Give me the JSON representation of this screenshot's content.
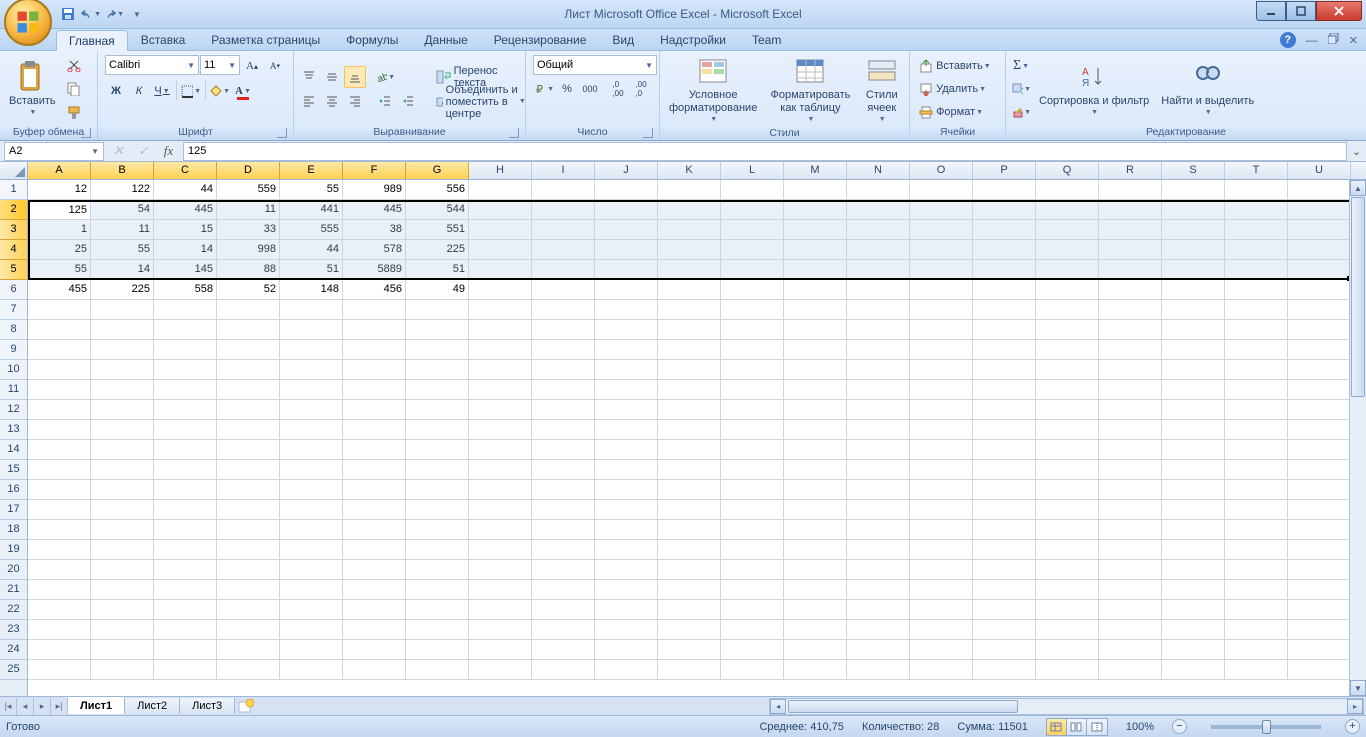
{
  "title": "Лист Microsoft Office Excel - Microsoft Excel",
  "tabs": [
    "Главная",
    "Вставка",
    "Разметка страницы",
    "Формулы",
    "Данные",
    "Рецензирование",
    "Вид",
    "Надстройки",
    "Team"
  ],
  "activeTab": 0,
  "ribbon": {
    "clipboard": {
      "label": "Буфер обмена",
      "paste": "Вставить"
    },
    "font": {
      "label": "Шрифт",
      "name": "Calibri",
      "size": "11",
      "bold": "Ж",
      "italic": "К",
      "underline": "Ч"
    },
    "alignment": {
      "label": "Выравнивание",
      "wrap": "Перенос текста",
      "merge": "Объединить и поместить в центре"
    },
    "number": {
      "label": "Число",
      "format": "Общий"
    },
    "styles": {
      "label": "Стили",
      "cond": "Условное форматирование",
      "table": "Форматировать как таблицу",
      "cell": "Стили ячеек"
    },
    "cells": {
      "label": "Ячейки",
      "insert": "Вставить",
      "delete": "Удалить",
      "format": "Формат"
    },
    "editing": {
      "label": "Редактирование",
      "sort": "Сортировка и фильтр",
      "find": "Найти и выделить"
    }
  },
  "namebox": "A2",
  "formula": "125",
  "columns": [
    "A",
    "B",
    "C",
    "D",
    "E",
    "F",
    "G",
    "H",
    "I",
    "J",
    "K",
    "L",
    "M",
    "N",
    "O",
    "P",
    "Q",
    "R",
    "S",
    "T",
    "U"
  ],
  "rows": 25,
  "selectedCols": 7,
  "selectedRows": [
    2,
    3,
    4,
    5
  ],
  "activeRow": 2,
  "data": [
    [
      12,
      122,
      44,
      559,
      55,
      989,
      556
    ],
    [
      125,
      54,
      445,
      11,
      441,
      445,
      544
    ],
    [
      1,
      11,
      15,
      33,
      555,
      38,
      551
    ],
    [
      25,
      55,
      14,
      998,
      44,
      578,
      225
    ],
    [
      55,
      14,
      145,
      88,
      51,
      5889,
      51
    ],
    [
      455,
      225,
      558,
      52,
      148,
      456,
      49
    ]
  ],
  "sheets": [
    "Лист1",
    "Лист2",
    "Лист3"
  ],
  "activeSheet": 0,
  "status": {
    "ready": "Готово",
    "avg_label": "Среднее:",
    "avg": "410,75",
    "count_label": "Количество:",
    "count": "28",
    "sum_label": "Сумма:",
    "sum": "11501",
    "zoom": "100%"
  }
}
